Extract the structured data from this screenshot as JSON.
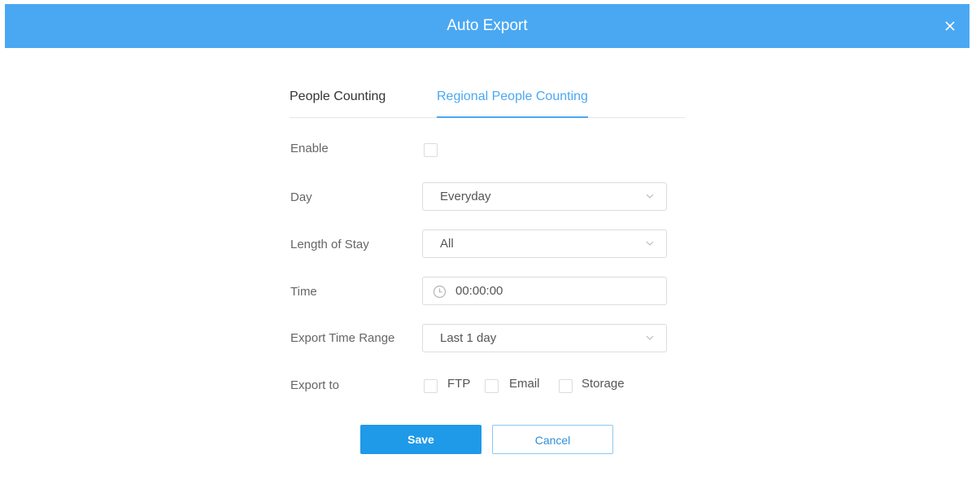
{
  "dialog": {
    "title": "Auto Export",
    "close_icon": "close-icon"
  },
  "tabs": [
    {
      "label": "People Counting",
      "active": false
    },
    {
      "label": "Regional People Counting",
      "active": true
    }
  ],
  "form": {
    "enable": {
      "label": "Enable",
      "checked": false
    },
    "day": {
      "label": "Day",
      "value": "Everyday"
    },
    "length_of_stay": {
      "label": "Length of Stay",
      "value": "All"
    },
    "time": {
      "label": "Time",
      "value": "00:00:00",
      "icon": "clock-icon"
    },
    "export_time_range": {
      "label": "Export Time Range",
      "value": "Last 1 day"
    },
    "export_to": {
      "label": "Export to",
      "options": [
        {
          "label": "FTP",
          "checked": false
        },
        {
          "label": "Email",
          "checked": false
        },
        {
          "label": "Storage",
          "checked": false
        }
      ]
    }
  },
  "buttons": {
    "save": "Save",
    "cancel": "Cancel"
  },
  "colors": {
    "accent": "#4aa8f2",
    "primary_button": "#1e9ae8"
  }
}
